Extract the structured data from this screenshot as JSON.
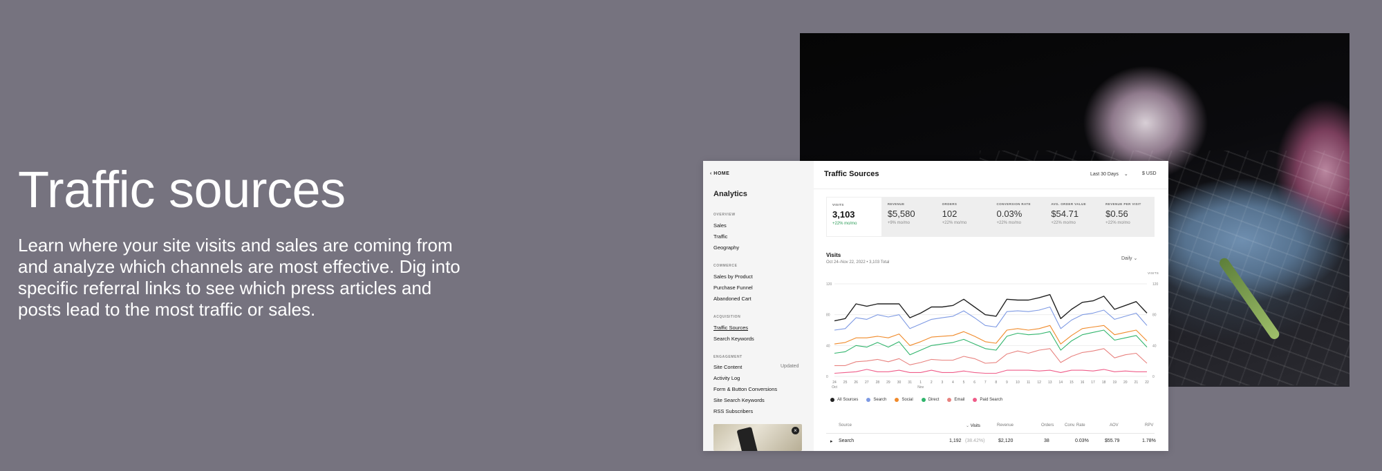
{
  "hero": {
    "title": "Traffic sources",
    "description": "Learn where your site visits and sales are coming from and analyze which channels are most effective. Dig into specific referral links to see which press articles and posts lead to the most traffic or sales."
  },
  "sidebar": {
    "home": "HOME",
    "title": "Analytics",
    "sections": {
      "overview": "OVERVIEW",
      "commerce": "COMMERCE",
      "acquisition": "ACQUISITION",
      "engagement": "ENGAGEMENT"
    },
    "items": {
      "sales": "Sales",
      "traffic": "Traffic",
      "geography": "Geography",
      "sales_by_product": "Sales by Product",
      "purchase_funnel": "Purchase Funnel",
      "abandoned_cart": "Abandoned Cart",
      "traffic_sources": "Traffic Sources",
      "search_keywords": "Search Keywords",
      "site_content": "Site Content",
      "updated": "Updated",
      "activity_log": "Activity Log",
      "form_button": "Form & Button Conversions",
      "site_search": "Site Search Keywords",
      "rss": "RSS Subscribers"
    }
  },
  "main": {
    "title": "Traffic Sources",
    "range": "Last 30 Days",
    "currency": "$ USD",
    "metrics": [
      {
        "label": "VISITS",
        "value": "3,103",
        "delta": "+22% mo/mo"
      },
      {
        "label": "REVENUE",
        "value": "$5,580",
        "delta": "+9% mo/mo"
      },
      {
        "label": "ORDERS",
        "value": "102",
        "delta": "+22% mo/mo"
      },
      {
        "label": "CONVERSION RATE",
        "value": "0.03%",
        "delta": "+22% mo/mo"
      },
      {
        "label": "AVG. ORDER VALUE",
        "value": "$54.71",
        "delta": "+22% mo/mo"
      },
      {
        "label": "REVENUE PER VISIT",
        "value": "$0.56",
        "delta": "+22% mo/mo"
      }
    ],
    "visits_title": "Visits",
    "visits_sub": "Oct 24–Nov 22, 2022 • 3,103 Total",
    "granularity": "Daily",
    "y_axis_name": "VISITS",
    "table": {
      "headers": {
        "source": "Source",
        "visits": "Visits",
        "revenue": "Revenue",
        "orders": "Orders",
        "conv": "Conv. Rate",
        "aov": "AOV",
        "rpv": "RPV"
      },
      "row": {
        "source": "Search",
        "visits": "1,192",
        "share": "(38.42%)",
        "revenue": "$2,120",
        "orders": "38",
        "conv": "0.03%",
        "aov": "$55.79",
        "rpv": "1.78%"
      }
    }
  },
  "chart_data": {
    "type": "line",
    "x": [
      "24",
      "25",
      "26",
      "27",
      "28",
      "29",
      "30",
      "31",
      "1",
      "2",
      "3",
      "4",
      "5",
      "6",
      "7",
      "8",
      "9",
      "10",
      "11",
      "12",
      "13",
      "14",
      "15",
      "16",
      "17",
      "18",
      "19",
      "20",
      "21",
      "22"
    ],
    "x_sublabels": {
      "0": "Oct",
      "8": "Nov"
    },
    "yticks_left": [
      "0",
      "40",
      "80",
      "120"
    ],
    "yticks_right": [
      "0",
      "40",
      "80",
      "120"
    ],
    "ylim": [
      0,
      120
    ],
    "series": [
      {
        "name": "All Sources",
        "color": "#222222",
        "values": [
          72,
          75,
          94,
          91,
          94,
          94,
          94,
          76,
          82,
          90,
          90,
          92,
          100,
          90,
          80,
          78,
          100,
          99,
          99,
          102,
          106,
          75,
          87,
          96,
          98,
          104,
          87,
          92,
          97,
          82
        ]
      },
      {
        "name": "Search",
        "color": "#7d99e3",
        "values": [
          60,
          62,
          76,
          74,
          80,
          77,
          80,
          62,
          68,
          74,
          76,
          78,
          85,
          76,
          66,
          64,
          84,
          85,
          84,
          86,
          90,
          62,
          73,
          80,
          82,
          86,
          74,
          78,
          82,
          66
        ]
      },
      {
        "name": "Social",
        "color": "#f08a2a",
        "values": [
          42,
          44,
          50,
          50,
          52,
          50,
          55,
          40,
          45,
          51,
          52,
          53,
          58,
          52,
          45,
          43,
          60,
          62,
          60,
          62,
          66,
          42,
          53,
          62,
          64,
          66,
          54,
          57,
          60,
          46
        ]
      },
      {
        "name": "Direct",
        "color": "#2fb46b",
        "values": [
          30,
          32,
          40,
          38,
          44,
          38,
          45,
          28,
          34,
          40,
          42,
          44,
          48,
          42,
          36,
          34,
          52,
          56,
          54,
          55,
          58,
          34,
          46,
          54,
          57,
          60,
          47,
          50,
          53,
          38
        ]
      },
      {
        "name": "Email",
        "color": "#e8827f",
        "values": [
          14,
          14,
          19,
          20,
          22,
          19,
          23,
          15,
          18,
          22,
          21,
          21,
          26,
          23,
          17,
          18,
          29,
          33,
          30,
          34,
          36,
          18,
          26,
          31,
          33,
          36,
          24,
          28,
          30,
          17
        ]
      },
      {
        "name": "Paid Search",
        "color": "#ef5b88",
        "values": [
          4,
          5,
          6,
          9,
          6,
          6,
          8,
          5,
          5,
          8,
          5,
          5,
          7,
          5,
          4,
          4,
          8,
          8,
          8,
          7,
          8,
          5,
          8,
          8,
          7,
          9,
          6,
          7,
          6,
          6
        ]
      }
    ]
  }
}
